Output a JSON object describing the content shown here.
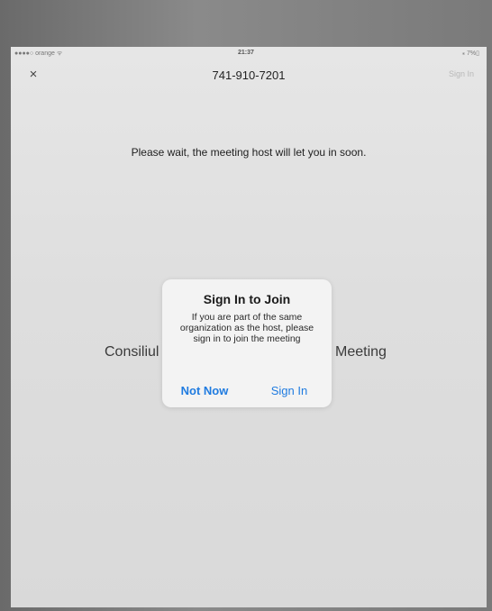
{
  "status_bar": {
    "carrier": "●●●●○ orange ᯤ",
    "time": "21:37",
    "battery": "⁎ 7%▯"
  },
  "nav": {
    "close_glyph": "×",
    "title": "741-910-7201",
    "sign_in": "Sign In"
  },
  "main": {
    "waiting_message": "Please wait, the meeting host will let you in soon.",
    "meeting_left": "Consiliul",
    "meeting_right": "Meeting"
  },
  "dialog": {
    "title": "Sign In to Join",
    "message": "If you are part of the same organization as the host, please sign in to join the meeting",
    "not_now": "Not Now",
    "sign_in": "Sign In"
  },
  "colors": {
    "accent": "#1f7be0",
    "screen_bg": "#e0e0e0",
    "dialog_bg": "#f3f3f3"
  }
}
